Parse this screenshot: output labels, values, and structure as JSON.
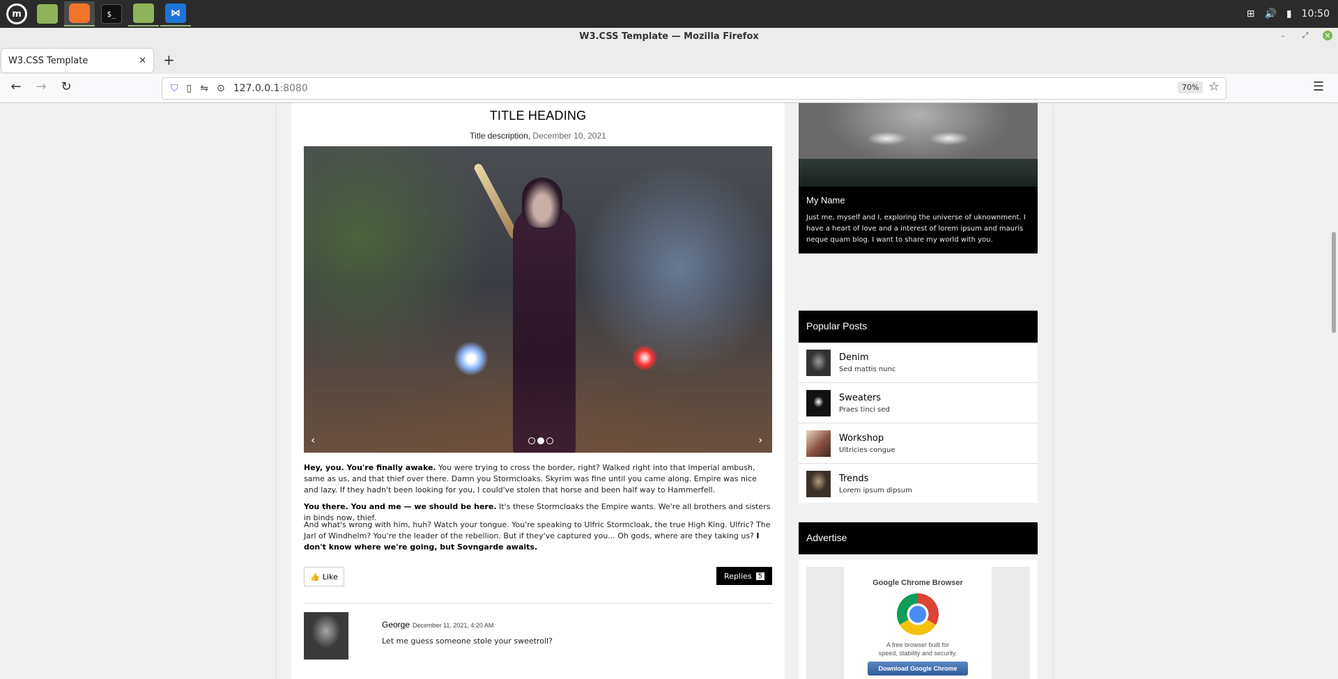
{
  "taskbar": {
    "apps": [
      {
        "name": "mint-menu-icon",
        "color": "#ffffff"
      },
      {
        "name": "files-icon",
        "color": "#8fb35a"
      },
      {
        "name": "firefox-icon",
        "color": "#f0742a"
      },
      {
        "name": "terminal-icon",
        "color": "#111111"
      },
      {
        "name": "folder-icon",
        "color": "#8fb35a"
      },
      {
        "name": "vscode-icon",
        "color": "#1e74d8"
      }
    ],
    "clock": "10:50"
  },
  "window": {
    "title": "W3.CSS Template — Mozilla Firefox"
  },
  "browser": {
    "tab_label": "W3.CSS Template",
    "url_host": "127.0.0.1",
    "url_port": ":8080",
    "zoom": "70%"
  },
  "post": {
    "heading": "TITLE HEADING",
    "description_label": "Title description,",
    "description_date": " December 10, 2021",
    "prev_arrow": "‹",
    "next_arrow": "›",
    "active_slide": 2,
    "slide_count": 3,
    "paragraphs": [
      {
        "bold": "Hey, you. You're finally awake.",
        "text": " You were trying to cross the border, right? Walked right into that Imperial ambush, same as us, and that thief over there. Damn you Stormcloaks. Skyrim was fine until you came along. Empire was nice and lazy. If they hadn't been looking for you, I could've stolen that horse and been half way to Hammerfell."
      },
      {
        "bold": "You there. You and me — we should be here.",
        "text": " It's these Stormcloaks the Empire wants. We're all brothers and sisters in binds now, thief."
      },
      {
        "text": "And what's wrong with him, huh? Watch your tongue. You're speaking to Ulfric Stormcloak, the true High King. Ulfric? The Jarl of Windhelm? You're the leader of the rebellion. But if they've captured you... Oh gods, where are they taking us? ",
        "bold": "I don't know where we're going, but Sovngarde awaits."
      }
    ],
    "like_label": "Like",
    "replies_label": "Replies",
    "replies_count": "5"
  },
  "comment": {
    "author": "George",
    "date": "December 11, 2021, 4:20 AM",
    "text": "Let me guess someone stole your sweetroll?"
  },
  "sidebar": {
    "about_title": "My Name",
    "about_text": "Just me, myself and I, exploring the universe of uknownment. I have a heart of love and a interest of lorem ipsum and mauris neque quam blog. I want to share my world with you.",
    "popular_header": "Popular Posts",
    "popular": [
      {
        "title": "Denim",
        "sub": "Sed mattis nunc"
      },
      {
        "title": "Sweaters",
        "sub": "Praes tinci sed"
      },
      {
        "title": "Workshop",
        "sub": "Ultricies congue"
      },
      {
        "title": "Trends",
        "sub": "Lorem ipsum dipsum"
      }
    ],
    "advertise_header": "Advertise",
    "ad": {
      "title": "Google Chrome Browser",
      "desc_line1": "A free browser built for",
      "desc_line2": "speed, stability and security.",
      "button": "Download Google Chrome"
    }
  }
}
